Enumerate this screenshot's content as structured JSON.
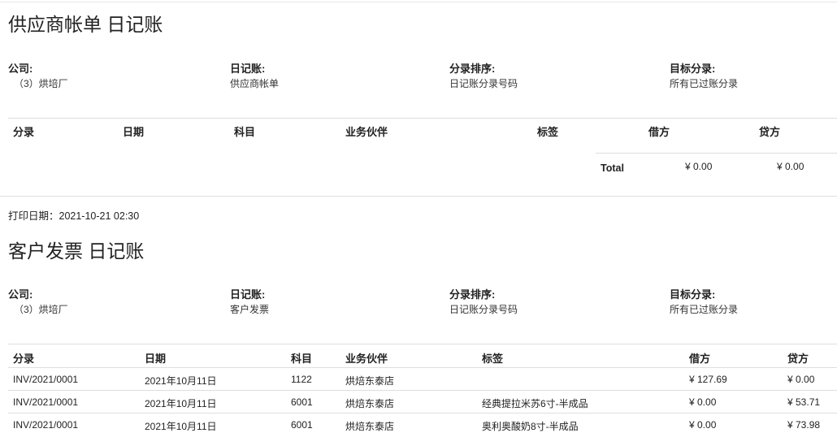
{
  "journals": [
    {
      "title": "供应商帐单 日记账",
      "info": {
        "company_label": "公司:",
        "company_value": "（3）烘培厂",
        "journal_label": "日记账:",
        "journal_value": "供应商帐单",
        "sort_label": "分录排序:",
        "sort_value": "日记账分录号码",
        "target_label": "目标分录:",
        "target_value": "所有已过账分录"
      },
      "headers": [
        "分录",
        "日期",
        "科目",
        "业务伙伴",
        "标签",
        "借方",
        "贷方"
      ],
      "rows": [],
      "total": {
        "label": "Total",
        "debit": "¥ 0.00",
        "credit": "¥ 0.00"
      }
    },
    {
      "title": "客户发票 日记账",
      "info": {
        "company_label": "公司:",
        "company_value": "（3）烘培厂",
        "journal_label": "日记账:",
        "journal_value": "客户发票",
        "sort_label": "分录排序:",
        "sort_value": "日记账分录号码",
        "target_label": "目标分录:",
        "target_value": "所有已过账分录"
      },
      "headers": [
        "分录",
        "日期",
        "科目",
        "业务伙伴",
        "标签",
        "借方",
        "贷方"
      ],
      "rows": [
        [
          "INV/2021/0001",
          "2021年10月11日",
          "1122",
          "烘焙东泰店",
          "",
          "¥ 127.69",
          "¥ 0.00"
        ],
        [
          "INV/2021/0001",
          "2021年10月11日",
          "6001",
          "烘焙东泰店",
          "经典提拉米苏6寸-半成品",
          "¥ 0.00",
          "¥ 53.71"
        ],
        [
          "INV/2021/0001",
          "2021年10月11日",
          "6001",
          "烘焙东泰店",
          "奥利奥酸奶8寸-半成品",
          "¥ 0.00",
          "¥ 73.98"
        ]
      ]
    }
  ],
  "print_date": "打印日期：2021-10-21 02:30"
}
